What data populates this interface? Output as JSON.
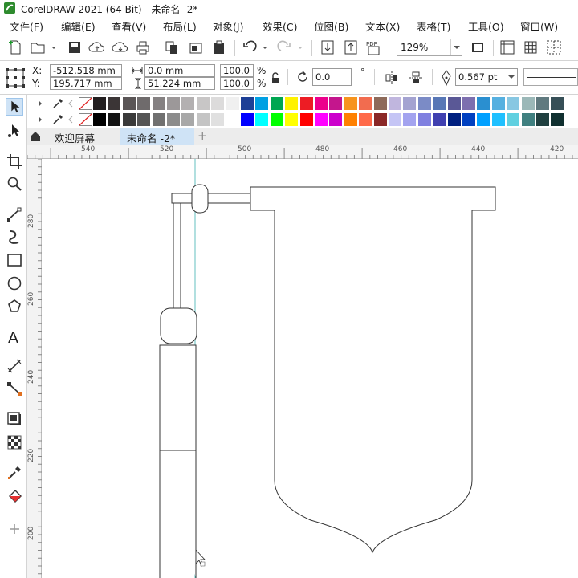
{
  "window": {
    "title": "CorelDRAW 2021 (64-Bit) - 未命名 -2*"
  },
  "menu": [
    "文件(F)",
    "编辑(E)",
    "查看(V)",
    "布局(L)",
    "对象(J)",
    "效果(C)",
    "位图(B)",
    "文本(X)",
    "表格(T)",
    "工具(O)",
    "窗口(W)"
  ],
  "toolbar": {
    "zoom": "129%"
  },
  "properties": {
    "x_label": "X:",
    "y_label": "Y:",
    "x_value": "-512.518 mm",
    "y_value": "195.717 mm",
    "width_value": "0.0 mm",
    "height_value": "51.224 mm",
    "scale_w": "100.0",
    "scale_h": "100.0",
    "percent": "%",
    "rotation": "0.0",
    "degree": "°",
    "outline_width": "0.567 pt"
  },
  "tabs": {
    "welcome": "欢迎屏幕",
    "document": "未命名 -2*",
    "add": "+"
  },
  "ruler": {
    "h_ticks": [
      "540",
      "520",
      "500",
      "480",
      "460",
      "440",
      "420"
    ],
    "v_ticks": [
      "280",
      "260",
      "240",
      "220",
      "200"
    ]
  },
  "palette": {
    "row1": [
      "#231f20",
      "#3b3536",
      "#5a5556",
      "#6f6b6c",
      "#858182",
      "#9c9899",
      "#b3b0b1",
      "#c8c6c6",
      "#dcdbdb",
      "#f0f0f0",
      "#1d3f96",
      "#00a0e3",
      "#00a651",
      "#fff200",
      "#ed1c24",
      "#ec008c",
      "#c4168d",
      "#f7941d",
      "#f26c4f",
      "#8e6a5a",
      "#c0b6de",
      "#a4a3d1",
      "#7b8bc6",
      "#5877b6",
      "#5a5896",
      "#7d6faf",
      "#2a8fd0",
      "#56b0e0",
      "#87c7e2",
      "#9bb8b8",
      "#607a7f",
      "#364f57"
    ],
    "row2": [
      "#000000",
      "#141414",
      "#3a3a3a",
      "#555555",
      "#707070",
      "#8c8c8c",
      "#a8a8a8",
      "#c4c4c4",
      "#e0e0e0",
      "#ffffff",
      "#0000ff",
      "#00ffff",
      "#00ff00",
      "#ffff00",
      "#ff0000",
      "#ff00ff",
      "#cc00cc",
      "#ff8000",
      "#ff6a4a",
      "#8b2828",
      "#c5c5f5",
      "#a3a3ef",
      "#8080e0",
      "#4040b0",
      "#002080",
      "#0040c0",
      "#00a0ff",
      "#20c0ff",
      "#60d0e0",
      "#408080",
      "#204040",
      "#103030"
    ]
  },
  "icons": [
    "corel-logo-icon",
    "new-icon",
    "open-icon",
    "save-icon",
    "upload-cloud-icon",
    "download-cloud-icon",
    "print-icon",
    "copy-icon",
    "cut-icon",
    "paste-icon",
    "undo-icon",
    "redo-icon",
    "import-icon",
    "export-icon",
    "pdf-icon",
    "full-screen-icon",
    "rulers-icon",
    "grid-icon",
    "guidelines-icon",
    "pick-tool-icon",
    "shape-tool-icon",
    "crop-tool-icon",
    "zoom-tool-icon",
    "freehand-tool-icon",
    "artistic-media-icon",
    "rectangle-tool-icon",
    "ellipse-tool-icon",
    "polygon-tool-icon",
    "text-tool-icon",
    "parallel-dimension-icon",
    "connector-tool-icon",
    "drop-shadow-icon",
    "transparency-icon",
    "eyedropper-icon",
    "interactive-fill-icon",
    "add-tool-icon",
    "home-icon",
    "lock-ratio-icon",
    "rotation-icon",
    "mirror-h-icon",
    "mirror-v-icon",
    "pen-icon",
    "outline-style-icon"
  ]
}
